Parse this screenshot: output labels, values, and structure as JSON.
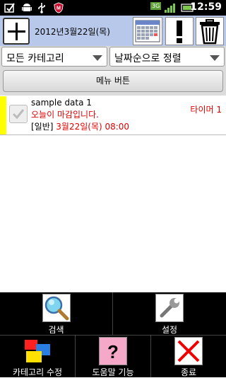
{
  "status_bar": {
    "time": "12:59",
    "network": "3G",
    "icons": [
      "notification-icon",
      "android-icon",
      "usb-icon",
      "security-shield-icon",
      "signal-icon",
      "battery-icon"
    ]
  },
  "header": {
    "date": "2012년3월22일(목)",
    "buttons": [
      "add-icon",
      "calendar-icon",
      "exclamation-icon",
      "trash-icon"
    ]
  },
  "filters": {
    "category": "모든 카테고리",
    "sort": "날짜순으로 정렬"
  },
  "menu_button": "메뉴 버튼",
  "items": [
    {
      "title": "sample data 1",
      "subtitle": "오늘이 마감입니다.",
      "category": "[일반]",
      "date": "3월22일(목) 08:00",
      "timer": "타이머 1",
      "stripe_color": "#ffff00"
    }
  ],
  "toolbar": {
    "search": "검색",
    "settings": "설정",
    "category_edit": "카테고리 수정",
    "help": "도움말 기능",
    "quit": "종료"
  },
  "colors": {
    "header_bg": "#b8c8ea",
    "accent_red": "#e00000",
    "toolbar_bg": "#000000"
  }
}
